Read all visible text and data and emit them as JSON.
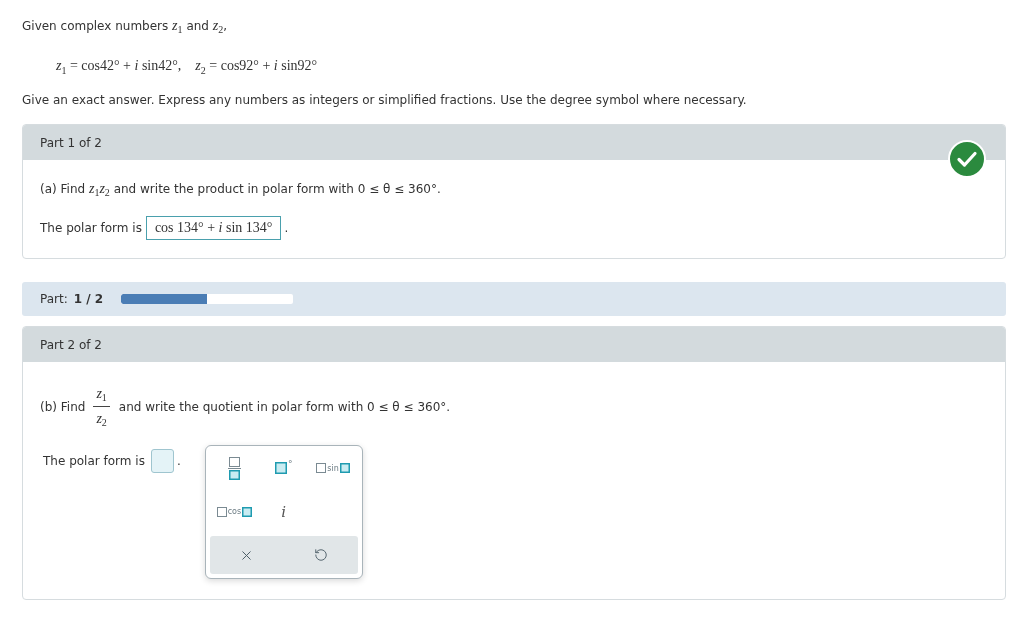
{
  "intro": {
    "text": "Given complex numbers *z*$_{1}$ and *z*$_{2}$,",
    "equations": [
      "*z*$_{1}$ = cos42° + *i* sin42°,",
      "*z*$_{2}$ = cos92° + *i* sin92°"
    ],
    "instructions": "Give an exact answer. Express any numbers as integers or simplified fractions. Use the degree symbol where necessary."
  },
  "parts": [
    {
      "header": "Part 1 of 2",
      "correct": true,
      "question": {
        "kind": "text",
        "text": "(a) Find *z*$_{1}$*z*$_{2}$ and write the product in polar form with 0 ≤ θ ≤ 360°."
      },
      "answer": {
        "label": "The polar form is",
        "value": "cos 134° + *i* sin 134°",
        "suffix": "."
      }
    },
    {
      "header": "Part 2 of 2",
      "question": {
        "kind": "fraction",
        "prefix": "(b) Find",
        "numerator": "*z*$_{1}$",
        "denominator": "*z*$_{2}$",
        "suffix": "and write the quotient in polar form with 0 ≤ θ ≤ 360°."
      },
      "answer": {
        "label": "The polar form is",
        "suffix": "."
      },
      "palette": {
        "keys": [
          {
            "kind": "fraction"
          },
          {
            "kind": "degree",
            "label": "°"
          },
          {
            "kind": "sin",
            "label": "sin"
          },
          {
            "kind": "cos",
            "label": "cos"
          },
          {
            "kind": "imaginary",
            "label": "i"
          }
        ],
        "actions": [
          {
            "kind": "clear"
          },
          {
            "kind": "undo"
          }
        ]
      }
    }
  ],
  "progress": {
    "label": "Part:",
    "value": "1 / 2",
    "level": 0.5
  }
}
